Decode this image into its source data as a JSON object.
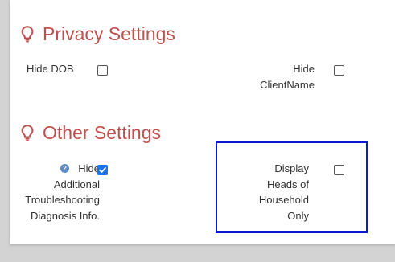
{
  "privacy_section": {
    "title": "Privacy Settings",
    "icon": "lightbulb-icon",
    "hide_dob": {
      "label": "Hide DOB",
      "checked": false
    },
    "hide_client_name": {
      "label_line1": "Hide",
      "label_line2": "ClientName",
      "checked": false
    }
  },
  "other_section": {
    "title": "Other Settings",
    "icon": "lightbulb-icon",
    "hide_troubleshooting": {
      "label_line1": "Hide",
      "label_line2": "Additional",
      "label_line3": "Troubleshooting",
      "label_line4": "Diagnosis Info.",
      "help_icon": "question-circle-icon",
      "checked": true
    },
    "display_heads": {
      "label_line1": "Display",
      "label_line2": "Heads of",
      "label_line3": "Household",
      "label_line4": "Only",
      "checked": false
    }
  },
  "colors": {
    "section_title": "#c0504d",
    "checkbox_checked": "#1a73e8",
    "highlight_border": "#0a1ad0",
    "help_icon": "#5b8bc9"
  }
}
